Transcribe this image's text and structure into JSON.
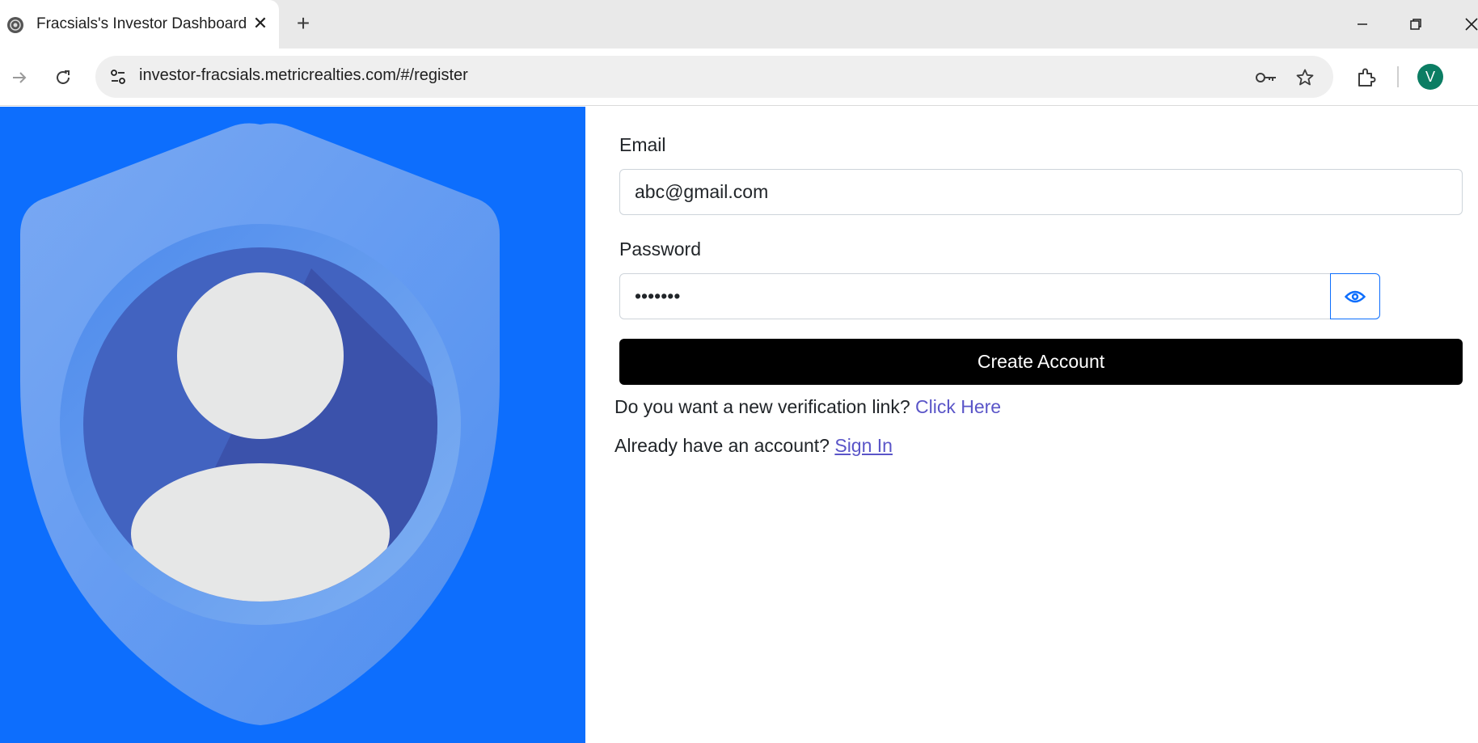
{
  "browser": {
    "tab": {
      "title": "Fracsials's Investor Dashboard",
      "close": "✕"
    },
    "new_tab": "+",
    "url": "investor-fracsials.metricrealties.com/#/register",
    "profile_initial": "V"
  },
  "form": {
    "email_label": "Email",
    "email_value": "abc@gmail.com",
    "password_label": "Password",
    "password_value": "•••••••",
    "submit_label": "Create Account",
    "verification_prompt": "Do you want a new verification link?",
    "verification_link": "Click Here",
    "signin_prompt": "Already have an account?",
    "signin_link": "Sign In"
  },
  "colors": {
    "panel_blue": "#0d6efd",
    "button_black": "#000000",
    "link": "#5a55c8"
  },
  "icons": [
    "site-favicon-icon",
    "close-icon",
    "plus-icon",
    "minimize-icon",
    "restore-icon",
    "window-close-icon",
    "forward-icon",
    "reload-icon",
    "site-info-icon",
    "key-icon",
    "star-icon",
    "extensions-icon",
    "eye-icon",
    "user-shield-illustration"
  ]
}
